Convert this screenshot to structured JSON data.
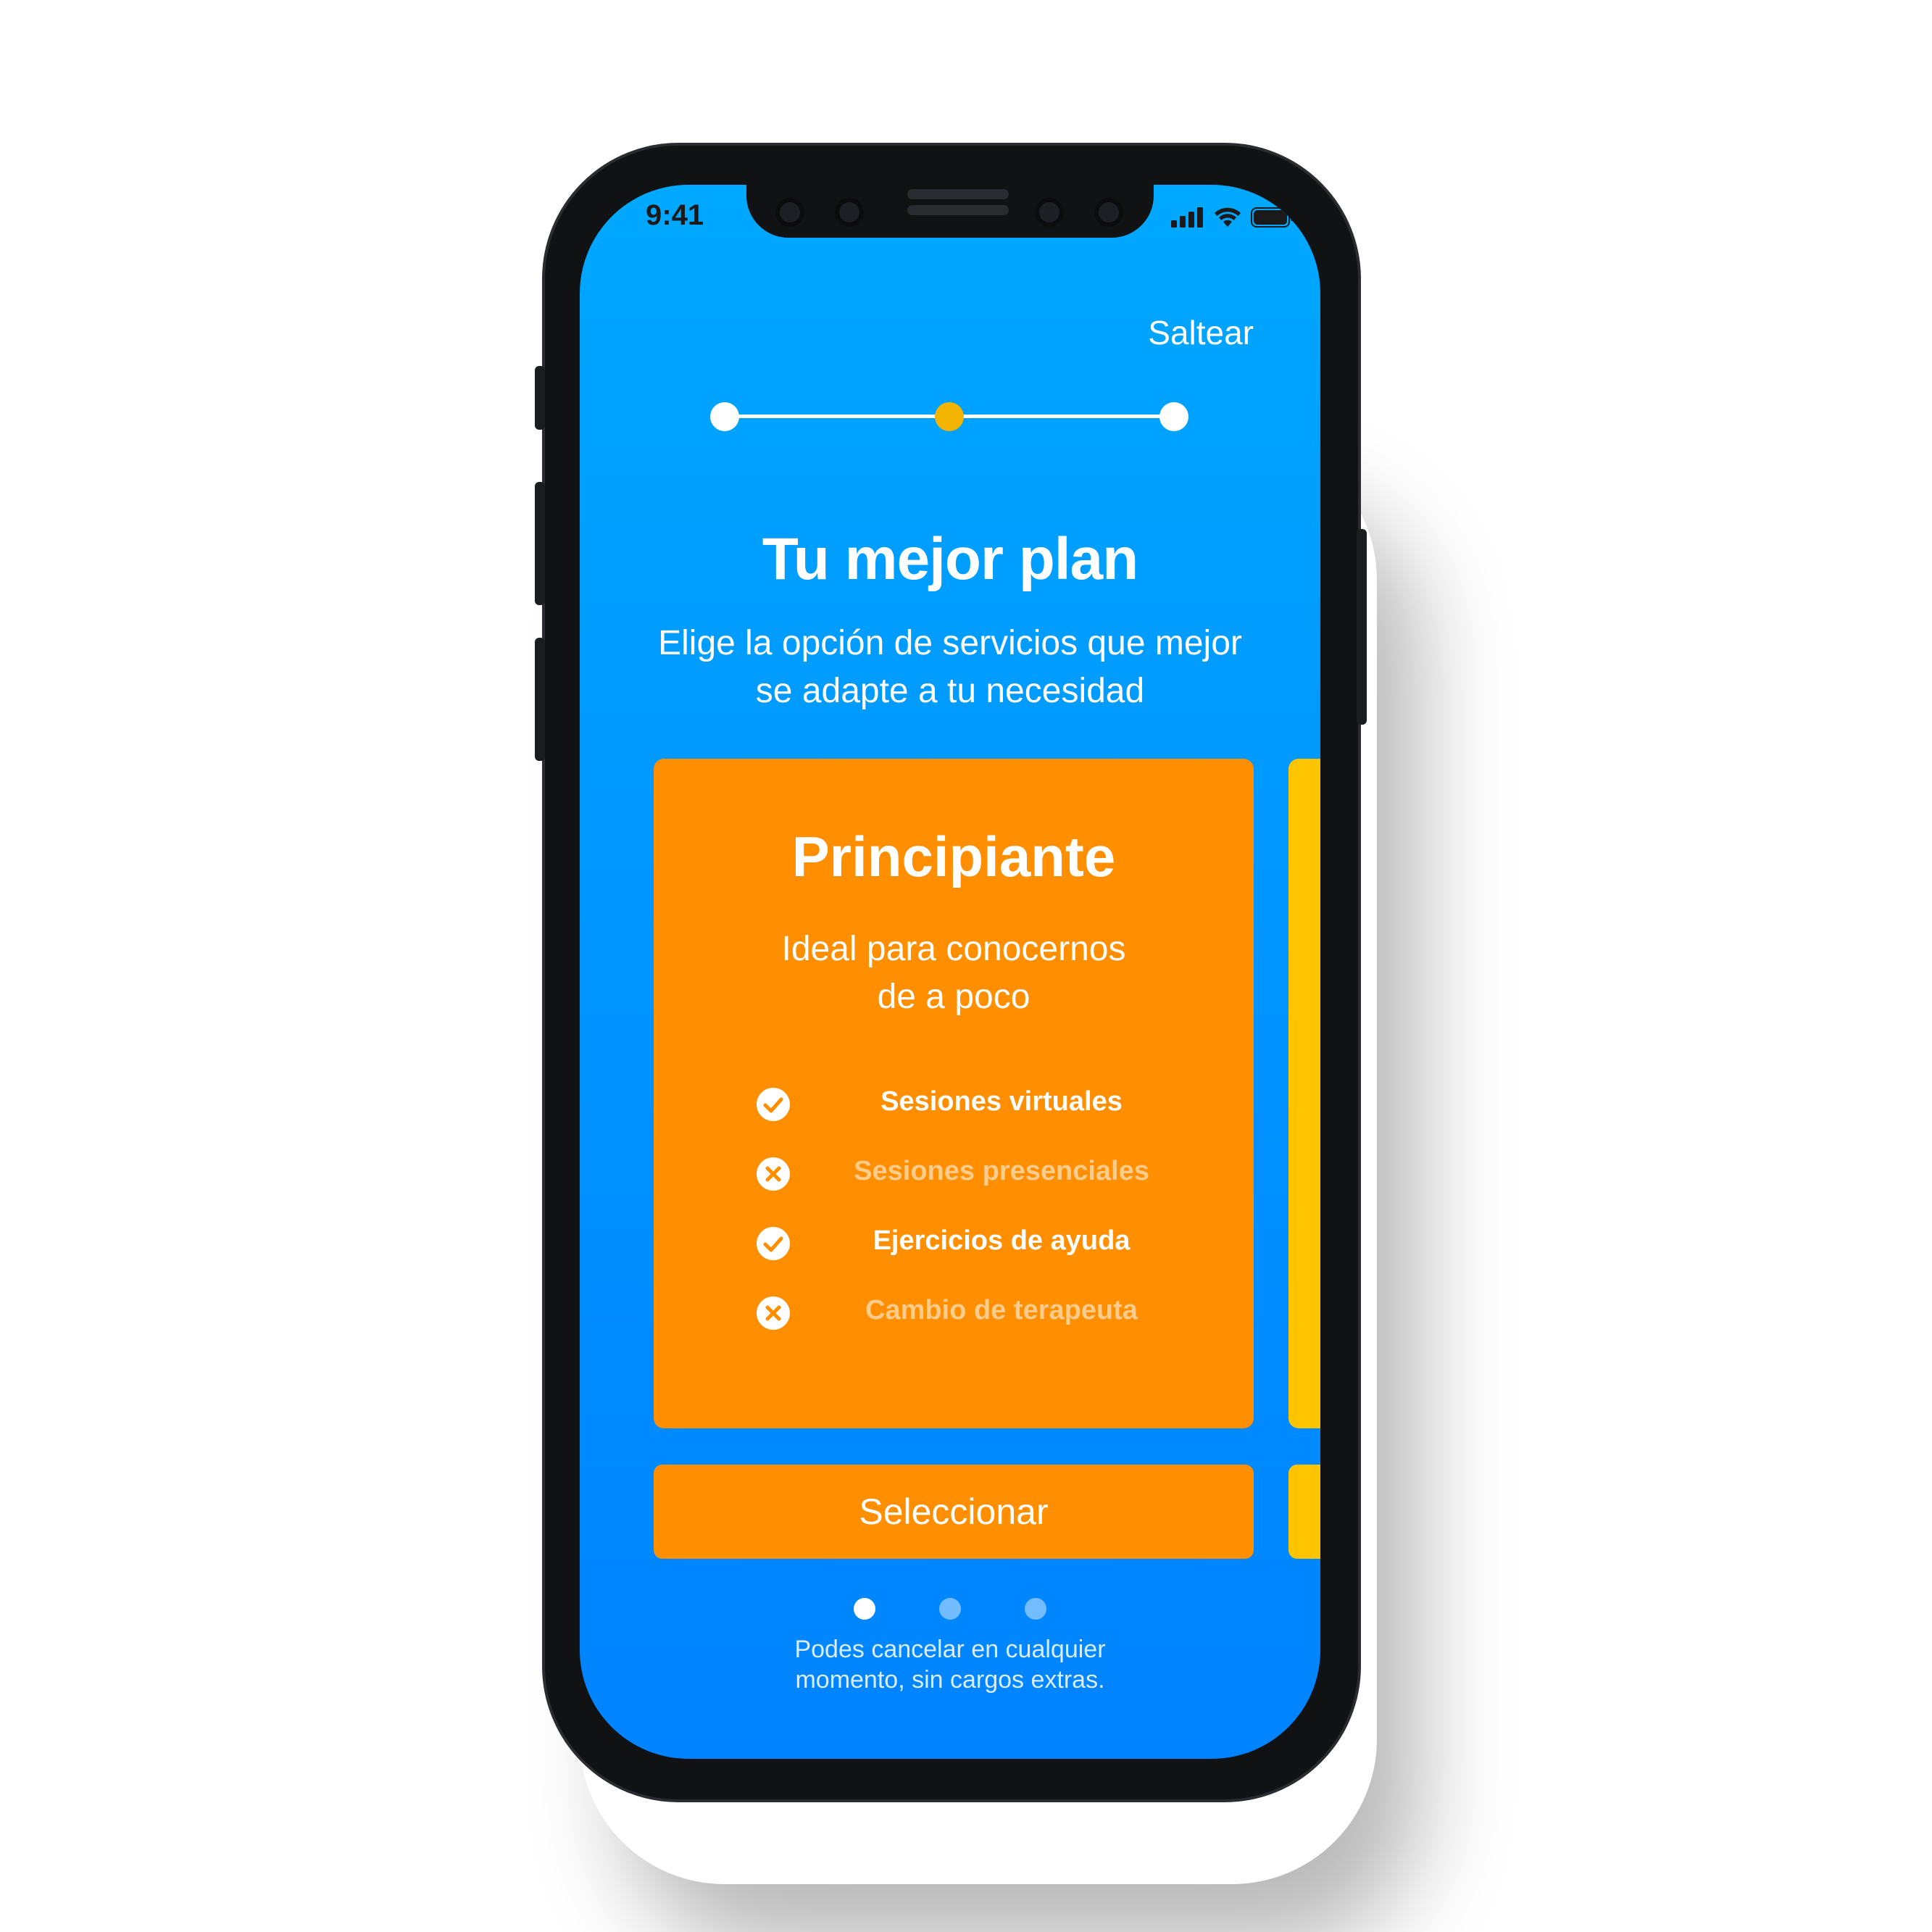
{
  "status_bar": {
    "time": "9:41",
    "icons": [
      "cellular-signal-icon",
      "wifi-icon",
      "battery-icon"
    ]
  },
  "header": {
    "skip_label": "Saltear"
  },
  "progress": {
    "steps_total": 3,
    "current_step": 2
  },
  "intro": {
    "title": "Tu mejor plan",
    "subtitle_line1": "Elige la opción de servicios que mejor",
    "subtitle_line2": "se adapte a tu necesidad"
  },
  "plan": {
    "name": "Principiante",
    "description_line1": "Ideal para conocernos",
    "description_line2": "de a poco",
    "features": [
      {
        "label": "Sesiones virtuales",
        "included": true
      },
      {
        "label": "Sesiones presenciales",
        "included": false
      },
      {
        "label": "Ejercicios de ayuda",
        "included": true
      },
      {
        "label": "Cambio de terapeuta",
        "included": false
      }
    ],
    "select_label": "Seleccionar"
  },
  "pager": {
    "pages_total": 3,
    "current_page": 1
  },
  "footer": {
    "line1": "Podes cancelar en cualquier",
    "line2": "momento, sin cargos extras."
  },
  "colors": {
    "background_top": "#00a8ff",
    "background_bottom": "#0083ff",
    "plan_card": "#ff8e00",
    "next_plan_card": "#ffc400",
    "active_step": "#f3b400"
  }
}
